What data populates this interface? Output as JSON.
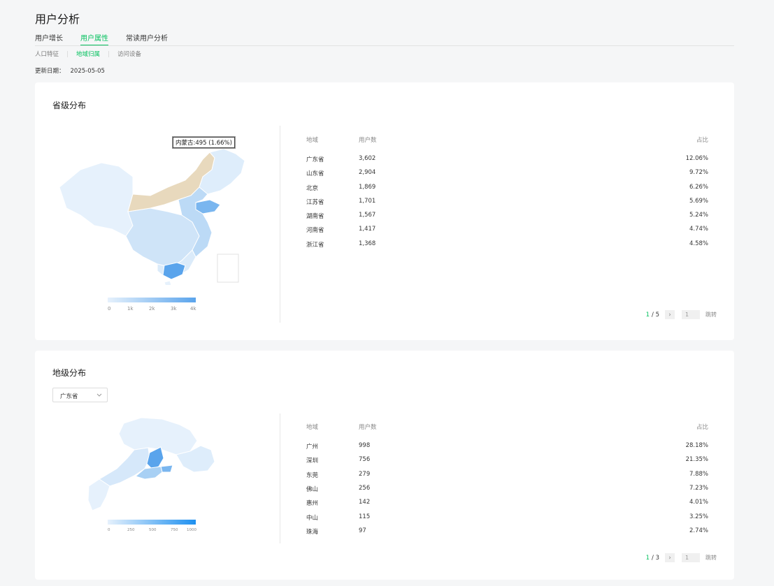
{
  "page": {
    "title": "用户分析"
  },
  "tabs": [
    {
      "label": "用户增长",
      "active": false
    },
    {
      "label": "用户属性",
      "active": true
    },
    {
      "label": "常读用户分析",
      "active": false
    }
  ],
  "subtabs": [
    {
      "label": "人口特征",
      "active": false
    },
    {
      "label": "地域归属",
      "active": true
    },
    {
      "label": "访问设备",
      "active": false
    }
  ],
  "update": {
    "label": "更新日期：",
    "date": "2025-05-05"
  },
  "colors": {
    "accent": "#07c160",
    "map_light": "#e6f1fc",
    "map_dark": "#5aa4ec",
    "map_highlight": "#e8d9bd"
  },
  "province": {
    "title": "省级分布",
    "tooltip": "内蒙古:495 (1.66%)",
    "legend_ticks": [
      "0",
      "1k",
      "2k",
      "3k",
      "4k"
    ],
    "headers": {
      "region": "地域",
      "users": "用户数",
      "ratio": "占比"
    },
    "rows": [
      {
        "region": "广东省",
        "users": "3,602",
        "ratio": "12.06%"
      },
      {
        "region": "山东省",
        "users": "2,904",
        "ratio": "9.72%"
      },
      {
        "region": "北京",
        "users": "1,869",
        "ratio": "6.26%"
      },
      {
        "region": "江苏省",
        "users": "1,701",
        "ratio": "5.69%"
      },
      {
        "region": "湖南省",
        "users": "1,567",
        "ratio": "5.24%"
      },
      {
        "region": "河南省",
        "users": "1,417",
        "ratio": "4.74%"
      },
      {
        "region": "浙江省",
        "users": "1,368",
        "ratio": "4.58%"
      }
    ],
    "pager": {
      "current": "1",
      "total": "/ 5",
      "input": "1",
      "go": "跳转"
    }
  },
  "city": {
    "title": "地级分布",
    "select_value": "广东省",
    "legend_ticks": [
      "0",
      "250",
      "500",
      "750",
      "1000"
    ],
    "headers": {
      "region": "地域",
      "users": "用户数",
      "ratio": "占比"
    },
    "rows": [
      {
        "region": "广州",
        "users": "998",
        "ratio": "28.18%"
      },
      {
        "region": "深圳",
        "users": "756",
        "ratio": "21.35%"
      },
      {
        "region": "东莞",
        "users": "279",
        "ratio": "7.88%"
      },
      {
        "region": "佛山",
        "users": "256",
        "ratio": "7.23%"
      },
      {
        "region": "惠州",
        "users": "142",
        "ratio": "4.01%"
      },
      {
        "region": "中山",
        "users": "115",
        "ratio": "3.25%"
      },
      {
        "region": "珠海",
        "users": "97",
        "ratio": "2.74%"
      }
    ],
    "pager": {
      "current": "1",
      "total": "/ 3",
      "input": "1",
      "go": "跳转"
    }
  }
}
